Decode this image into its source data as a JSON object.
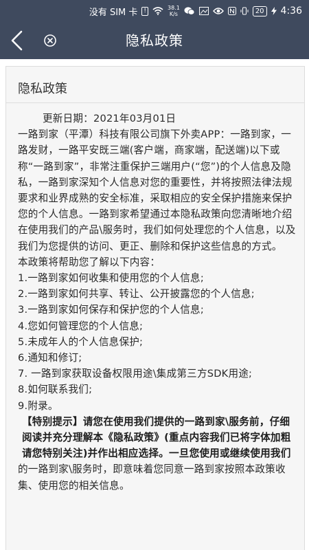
{
  "status_bar": {
    "carrier": "没有 SIM 卡",
    "alert": "!",
    "speed_value": "38.1",
    "speed_unit": "K/s",
    "battery": "20",
    "time": "4:36"
  },
  "header": {
    "title": "隐私政策"
  },
  "document": {
    "heading": "隐私政策",
    "update_date": "更新日期：2021年03月01日",
    "paragraphs": [
      "一路到家（平潭）科技有限公司旗下外卖APP：一路到家，一路发财，一路平安既三端(客户端，商家端，配送端)以下或称“一路到家”，非常注重保护三端用户(“您”)的个人信息及隐私，一路到家深知个人信息对您的重要性，并将按照法律法规要求和业界成熟的安全标准，采取相应的安全保护措施来保护您的个人信息。一路到家希望通过本隐私政策向您清晰地介绍在使用我们的产品\\服务时，我们如何处理您的个人信息，以及我们为您提供的访问、更正、删除和保护这些信息的方式。",
      "本政策将帮助您了解以下内容："
    ],
    "list_items": [
      "1.一路到家如何收集和使用您的个人信息;",
      "2.一路到家如何共享、转让、公开披露您的个人信息;",
      "3.一路到家如何保存和保护您的个人信息;",
      "4.您如何管理您的个人信息;",
      "5.未成年人的个人信息保护;",
      "6.通知和修订;",
      "7. 一路到家获取设备权限用途\\集成第三方SDK用途;",
      "8.如何联系我们;",
      "9.附录。"
    ],
    "special_notice": "【特别提示】请您在使用我们提供的一路到家\\服务前，仔细阅读并充分理解本《隐私政策》(重点内容我们已将字体加粗请您特别关注)并作出相应选择。一旦您使用或继续使用我们",
    "continuation": "的一路到家\\服务时，即意味着您同意一路到家按照本政策收集、使用您的相关信息。"
  },
  "colors": {
    "header_bg": "#3f4a5e",
    "card_bg": "#f6f6f6"
  }
}
